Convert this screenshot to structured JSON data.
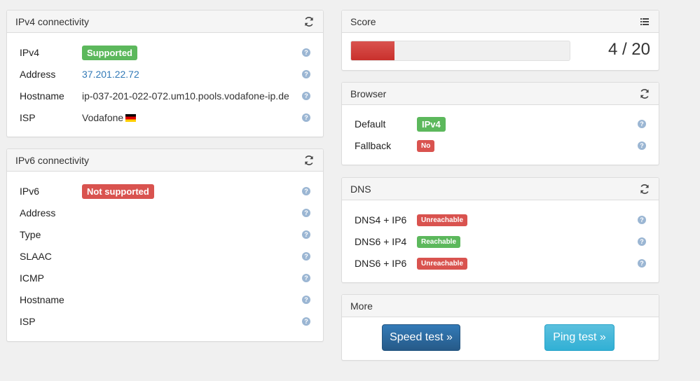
{
  "ipv4": {
    "title": "IPv4 connectivity",
    "rows": [
      {
        "label": "IPv4",
        "badge": "Supported"
      },
      {
        "label": "Address",
        "value": "37.201.22.72"
      },
      {
        "label": "Hostname",
        "value": "ip-037-201-022-072.um10.pools.vodafone-ip.de"
      },
      {
        "label": "ISP",
        "value": "Vodafone"
      }
    ]
  },
  "ipv6": {
    "title": "IPv6 connectivity",
    "rows": [
      {
        "label": "IPv6",
        "badge": "Not supported"
      },
      {
        "label": "Address"
      },
      {
        "label": "Type"
      },
      {
        "label": "SLAAC"
      },
      {
        "label": "ICMP"
      },
      {
        "label": "Hostname"
      },
      {
        "label": "ISP"
      }
    ]
  },
  "score": {
    "title": "Score",
    "text": "4 / 20",
    "value": 4,
    "max": 20
  },
  "browser": {
    "title": "Browser",
    "rows": [
      {
        "label": "Default",
        "badge": "IPv4"
      },
      {
        "label": "Fallback",
        "badge": "No"
      }
    ]
  },
  "dns": {
    "title": "DNS",
    "rows": [
      {
        "label": "DNS4 + IP6",
        "badge": "Unreachable"
      },
      {
        "label": "DNS6 + IP4",
        "badge": "Reachable"
      },
      {
        "label": "DNS6 + IP6",
        "badge": "Unreachable"
      }
    ]
  },
  "more": {
    "title": "More",
    "speed_test": "Speed test »",
    "ping_test": "Ping test »"
  },
  "help_glyph": "?",
  "icons": {
    "refresh": "refresh-icon",
    "list": "list-icon",
    "help": "help-icon",
    "flag": "germany-flag-icon"
  },
  "colors": {
    "success": "#5cb85c",
    "danger": "#d9534f",
    "primary": "#337ab7",
    "info": "#5bc0de",
    "link": "#337ab7"
  }
}
